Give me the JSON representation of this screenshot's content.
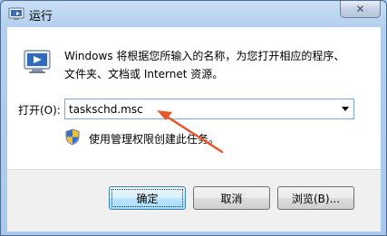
{
  "window": {
    "title": "运行",
    "close_icon": "close-icon",
    "title_icon": "run-icon"
  },
  "content": {
    "app_icon": "run-app-icon",
    "description_line1": "Windows 将根据您所输入的名称，为您打开相应的程序、",
    "description_line2": "文件夹、文档或 Internet 资源。",
    "open_label": "打开(O):",
    "open_value": "taskschd.msc",
    "admin_icon": "uac-shield-icon",
    "admin_text": "使用管理权限创建此任务。"
  },
  "buttons": {
    "ok": "确定",
    "cancel": "取消",
    "browse": "浏览(B)..."
  },
  "annotation": {
    "arrow_color": "#e8562a"
  }
}
